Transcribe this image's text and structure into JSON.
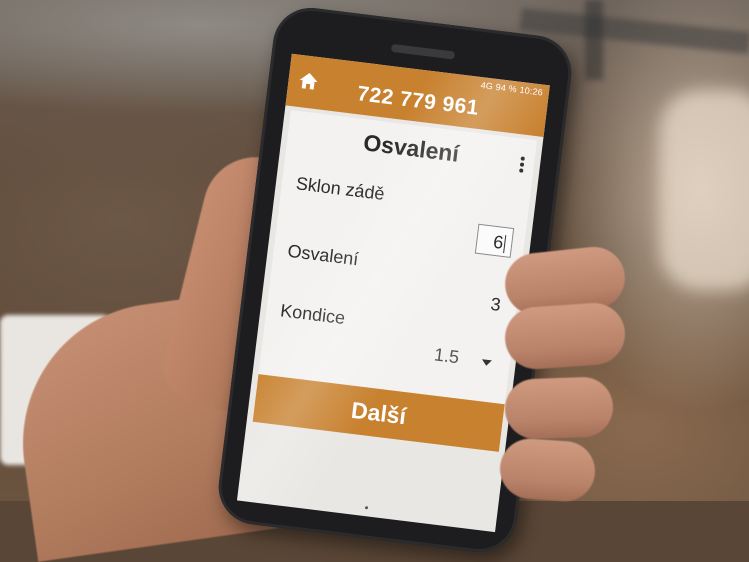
{
  "header": {
    "phone_number": "722 779 961",
    "status": "4G  94 %  10:26"
  },
  "form": {
    "title": "Osvalení",
    "rows": [
      {
        "label": "Sklon zádě",
        "value": "6"
      },
      {
        "label": "Osvalení",
        "value": "3"
      },
      {
        "label": "Kondice",
        "value": "1.5"
      }
    ],
    "next_label": "Další"
  },
  "colors": {
    "accent": "#c8812f"
  },
  "icons": {
    "home": "home-icon",
    "menu": "more-vertical-icon",
    "dropdown": "chevron-down-icon"
  }
}
